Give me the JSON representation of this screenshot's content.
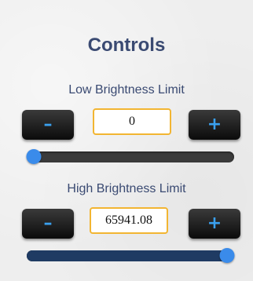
{
  "panel": {
    "title": "Controls"
  },
  "low": {
    "label": "Low Brightness Limit",
    "minus_label": "–",
    "plus_label": "+",
    "value": "0",
    "slider_fraction": 0.0
  },
  "high": {
    "label": "High Brightness Limit",
    "minus_label": "–",
    "plus_label": "+",
    "value": "65941.08",
    "slider_fraction": 1.0
  },
  "colors": {
    "title_text": "#3a4a72",
    "button_glyph": "#3aa0ee",
    "input_border": "#f2b532",
    "slider_thumb": "#3a8bea",
    "slider_fill_high": "#1f3b63"
  },
  "icons": {
    "decrement": "minus-icon",
    "increment": "plus-icon"
  }
}
